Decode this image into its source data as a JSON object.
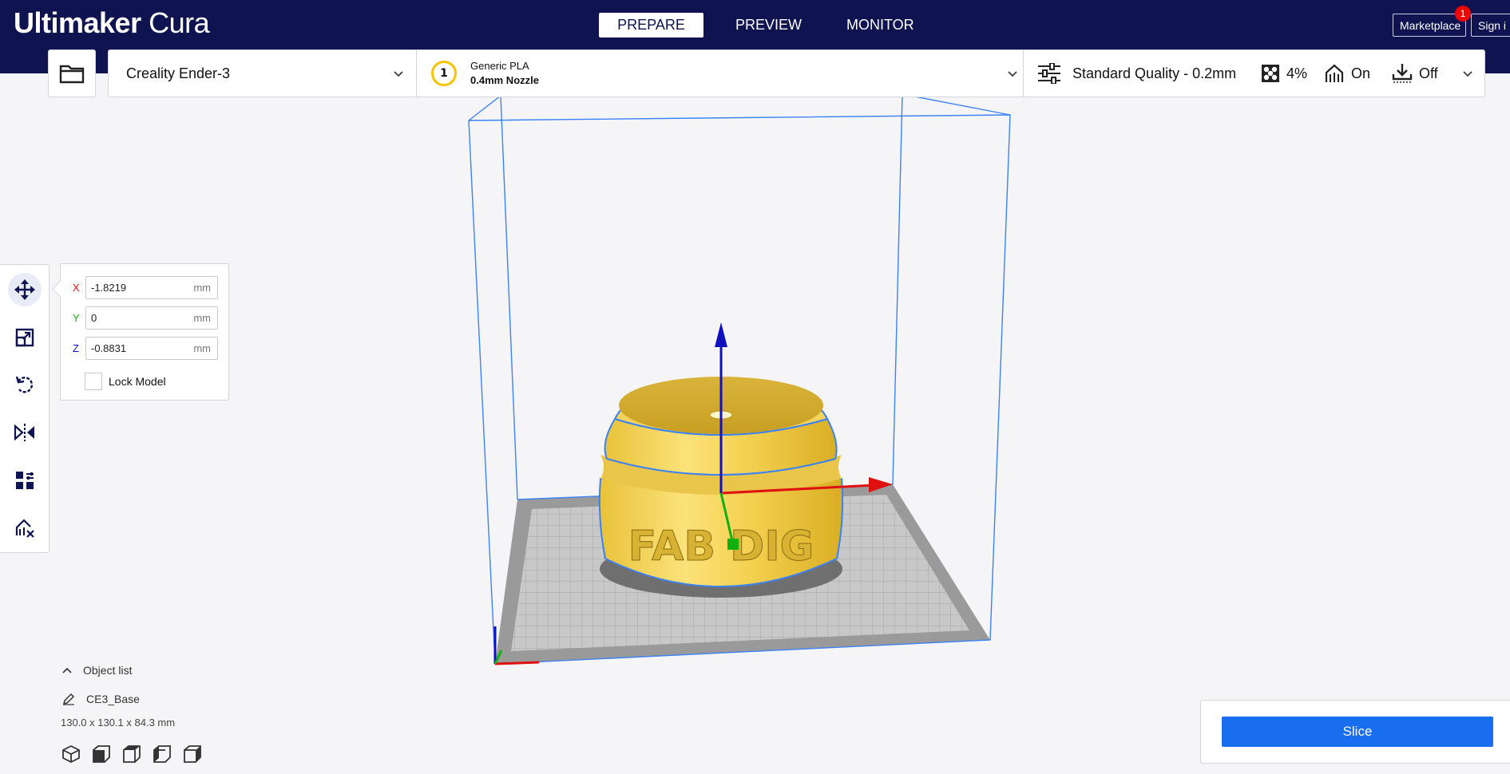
{
  "app": {
    "brand_bold": "Ultimaker",
    "brand_light": " Cura"
  },
  "header": {
    "tabs": [
      {
        "label": "PREPARE"
      },
      {
        "label": "PREVIEW"
      },
      {
        "label": "MONITOR"
      }
    ],
    "marketplace_label": "Marketplace",
    "marketplace_badge": "1",
    "signin_label": "Sign i"
  },
  "config": {
    "printer": "Creality Ender-3",
    "extruder_number": "1",
    "material": "Generic PLA",
    "nozzle": "0.4mm Nozzle",
    "quality": "Standard Quality - 0.2mm",
    "infill": "4%",
    "support": "On",
    "adhesion": "Off"
  },
  "move_panel": {
    "x_label": "X",
    "x_value": "-1.8219",
    "y_label": "Y",
    "y_value": "0",
    "z_label": "Z",
    "z_value": "-0.8831",
    "unit": "mm",
    "lock_label": "Lock Model"
  },
  "object_list": {
    "header": "Object list",
    "name": "CE3_Base",
    "dimensions": "130.0 x 130.1 x 84.3 mm"
  },
  "model_text": "FAB DIG",
  "slice": {
    "label": "Slice"
  },
  "colors": {
    "header_bg": "#0f1451",
    "accent": "#196ef0",
    "model": "#f7d55a"
  }
}
